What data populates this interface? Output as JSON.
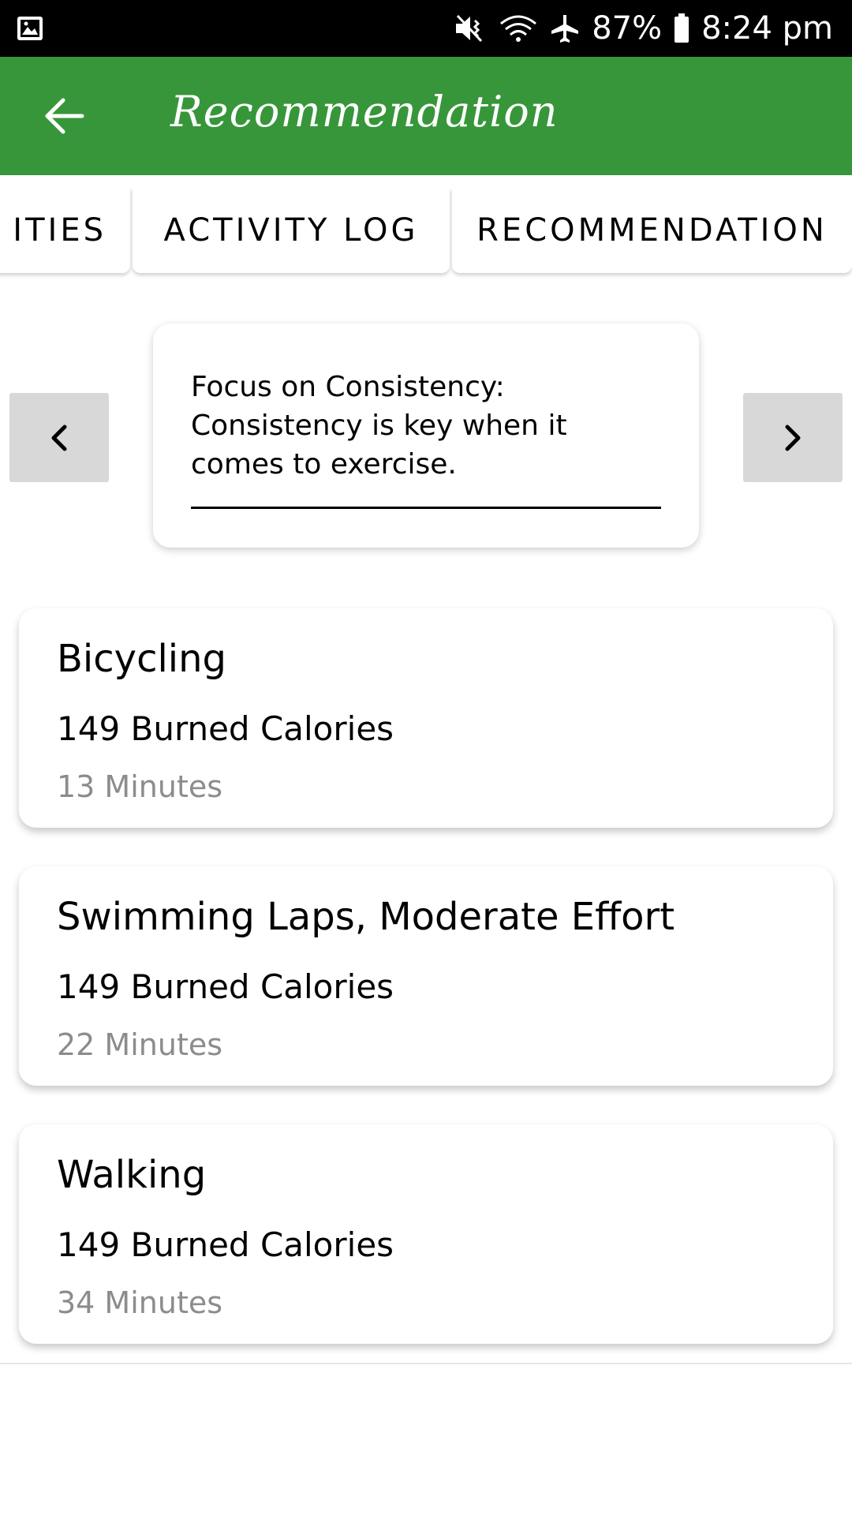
{
  "status_bar": {
    "battery": "87%",
    "time": "8:24 pm",
    "icons": [
      "gallery-icon",
      "mute-vibrate-icon",
      "wifi-icon",
      "airplane-icon",
      "battery-icon"
    ]
  },
  "app_bar": {
    "title": "Recommendation",
    "back_icon": "arrow-left-icon",
    "color": "#38963a"
  },
  "tabs": [
    {
      "label": "ITIES",
      "selected": false
    },
    {
      "label": "ACTIVITY LOG",
      "selected": false
    },
    {
      "label": "RECOMMENDATION",
      "selected": true
    }
  ],
  "carousel": {
    "tip_text": "Focus on Consistency: Consistency is key when it comes to exercise.",
    "prev_icon": "chevron-left-icon",
    "next_icon": "chevron-right-icon"
  },
  "activities": [
    {
      "name": "Bicycling",
      "calories": "149 Burned Calories",
      "minutes": "13 Minutes"
    },
    {
      "name": "Swimming Laps, Moderate Effort",
      "calories": "149 Burned Calories",
      "minutes": "22 Minutes"
    },
    {
      "name": "Walking",
      "calories": "149 Burned Calories",
      "minutes": "34 Minutes"
    }
  ]
}
